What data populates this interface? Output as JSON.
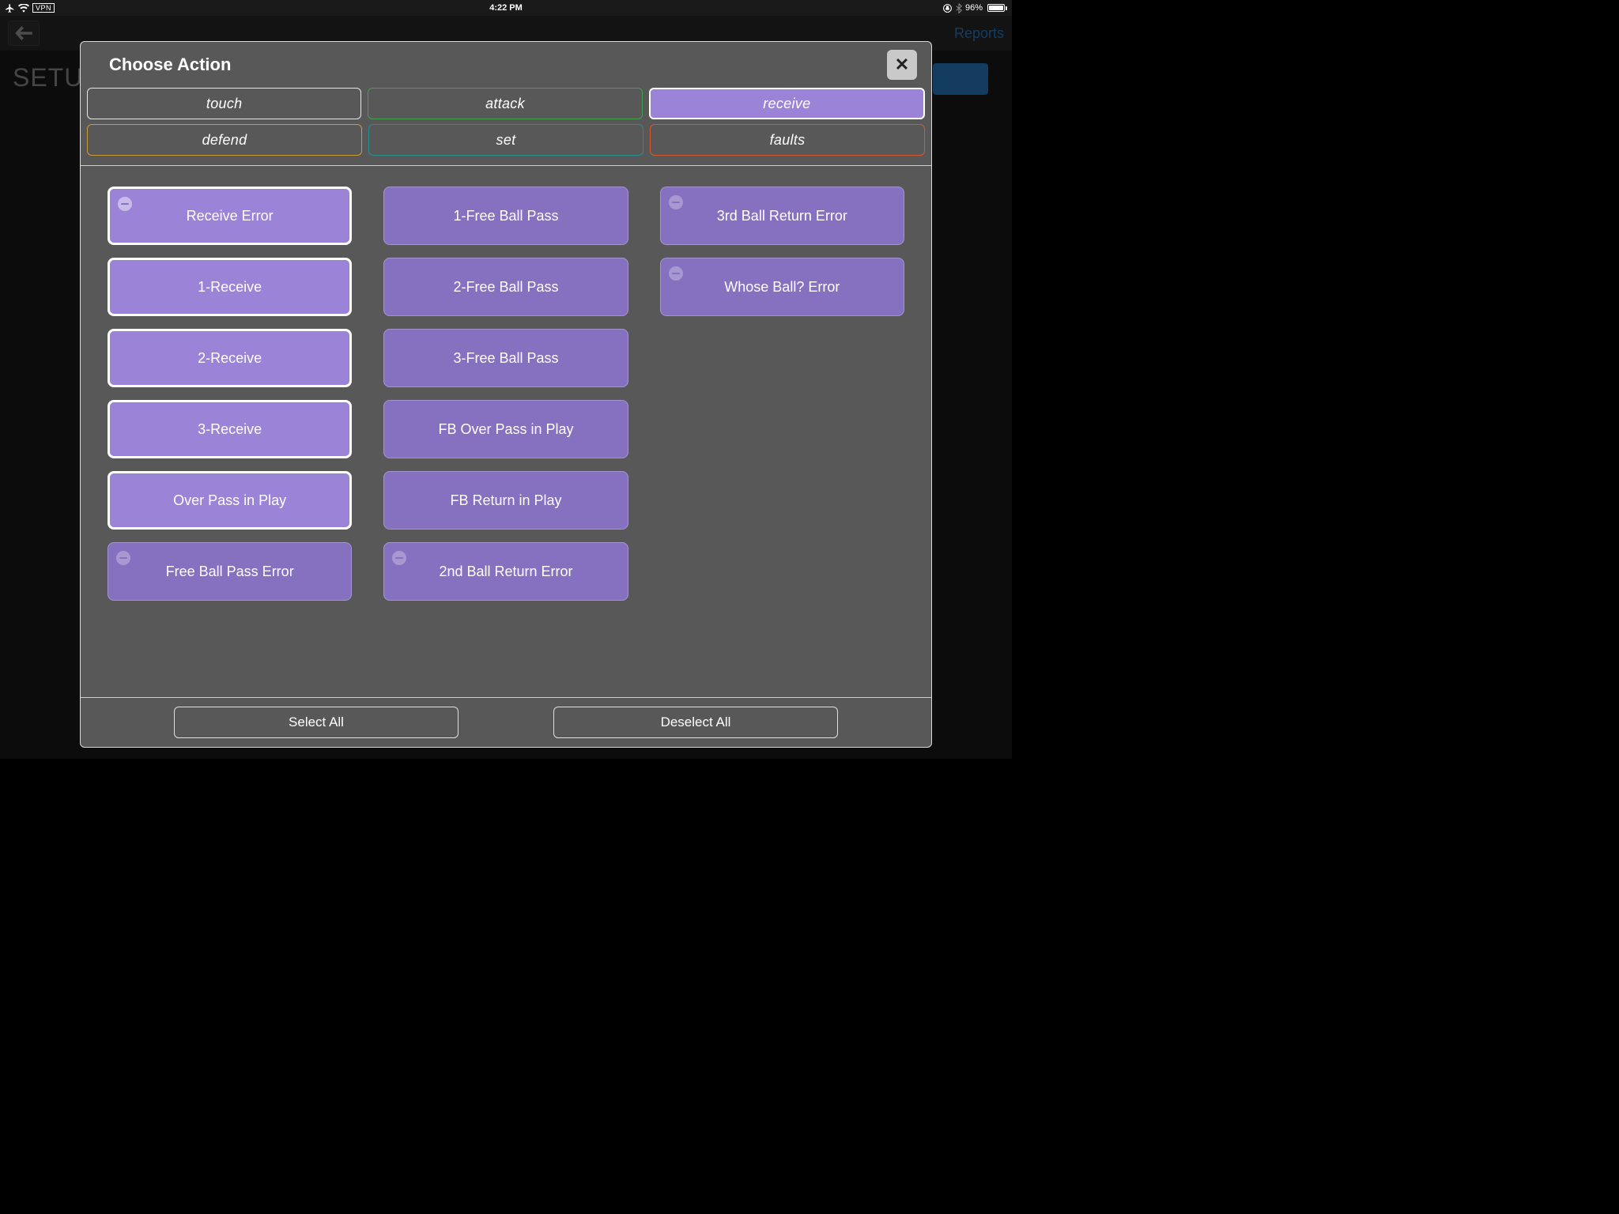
{
  "status": {
    "time": "4:22 PM",
    "vpn": "VPN",
    "battery_pct": "96%"
  },
  "background": {
    "reports": "Reports",
    "setup": "SETUP"
  },
  "modal": {
    "title": "Choose Action",
    "close": "✕",
    "categories": {
      "touch": "touch",
      "attack": "attack",
      "receive": "receive",
      "defend": "defend",
      "set": "set",
      "faults": "faults"
    },
    "columns": [
      [
        {
          "label": "Receive Error",
          "selected": true,
          "badge": true
        },
        {
          "label": "1-Receive",
          "selected": true,
          "badge": false
        },
        {
          "label": "2-Receive",
          "selected": true,
          "badge": false
        },
        {
          "label": "3-Receive",
          "selected": true,
          "badge": false
        },
        {
          "label": "Over Pass in Play",
          "selected": true,
          "badge": false
        },
        {
          "label": "Free Ball Pass Error",
          "selected": false,
          "badge": true
        }
      ],
      [
        {
          "label": "1-Free Ball Pass",
          "selected": false,
          "badge": false
        },
        {
          "label": "2-Free Ball Pass",
          "selected": false,
          "badge": false
        },
        {
          "label": "3-Free Ball Pass",
          "selected": false,
          "badge": false
        },
        {
          "label": "FB Over Pass in Play",
          "selected": false,
          "badge": false
        },
        {
          "label": "FB Return in Play",
          "selected": false,
          "badge": false
        },
        {
          "label": "2nd Ball Return Error",
          "selected": false,
          "badge": true
        }
      ],
      [
        {
          "label": "3rd Ball Return Error",
          "selected": false,
          "badge": true
        },
        {
          "label": "Whose Ball? Error",
          "selected": false,
          "badge": true
        }
      ]
    ],
    "footer": {
      "select_all": "Select All",
      "deselect_all": "Deselect All"
    }
  }
}
